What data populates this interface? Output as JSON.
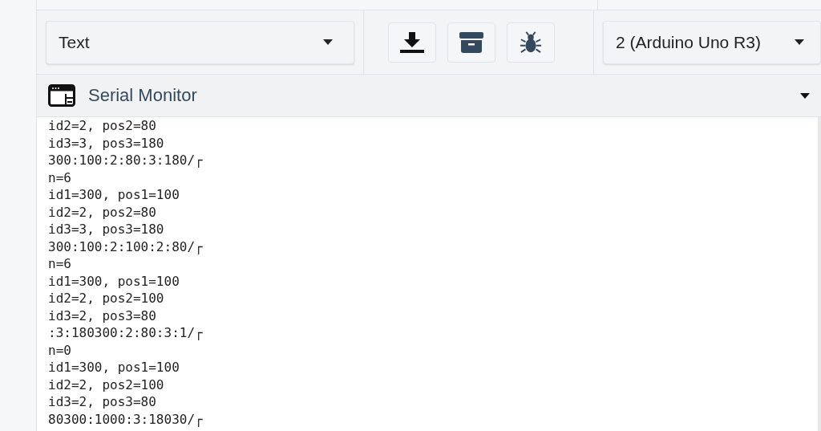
{
  "toolbar": {
    "format_select": {
      "value": "Text"
    },
    "buttons": [
      {
        "kind": "download"
      },
      {
        "kind": "archive"
      },
      {
        "kind": "debug"
      }
    ],
    "device_select": {
      "value": "2 (Arduino Uno R3)"
    }
  },
  "panel": {
    "title": "Serial Monitor",
    "expanded": true
  },
  "output_lines": [
    "id2=2, pos2=80",
    "id3=3, pos3=180",
    "300:100:2:80:3:180/┌",
    "n=6",
    "id1=300, pos1=100",
    "id2=2, pos2=80",
    "id3=3, pos3=180",
    "300:100:2:100:2:80/┌",
    "n=6",
    "id1=300, pos1=100",
    "id2=2, pos2=100",
    "id3=2, pos3=80",
    ":3:180300:2:80:3:1/┌",
    "n=0",
    "id1=300, pos1=100",
    "id2=2, pos2=100",
    "id3=2, pos3=80",
    "80300:1000:3:18030/┌"
  ]
}
